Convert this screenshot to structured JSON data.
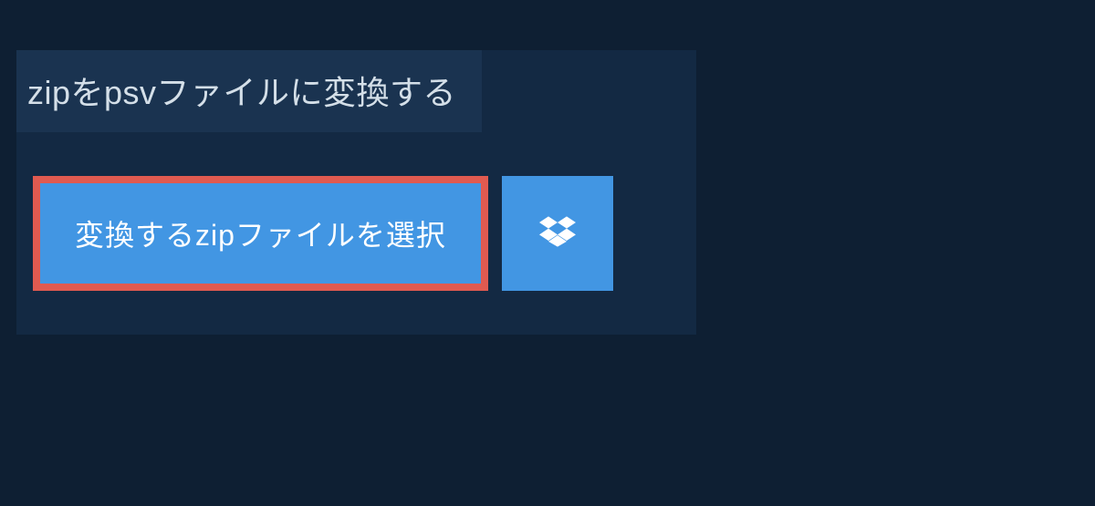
{
  "heading": "zipをpsvファイルに変換する",
  "buttons": {
    "select_file_label": "変換するzipファイルを選択",
    "dropbox_icon": "dropbox-icon"
  },
  "colors": {
    "page_bg": "#0e1f33",
    "panel_bg": "#132943",
    "heading_bg": "#1a3350",
    "button_bg": "#4296e3",
    "button_border": "#e05a50",
    "text_light": "#d4dfe8",
    "text_white": "#ffffff"
  }
}
